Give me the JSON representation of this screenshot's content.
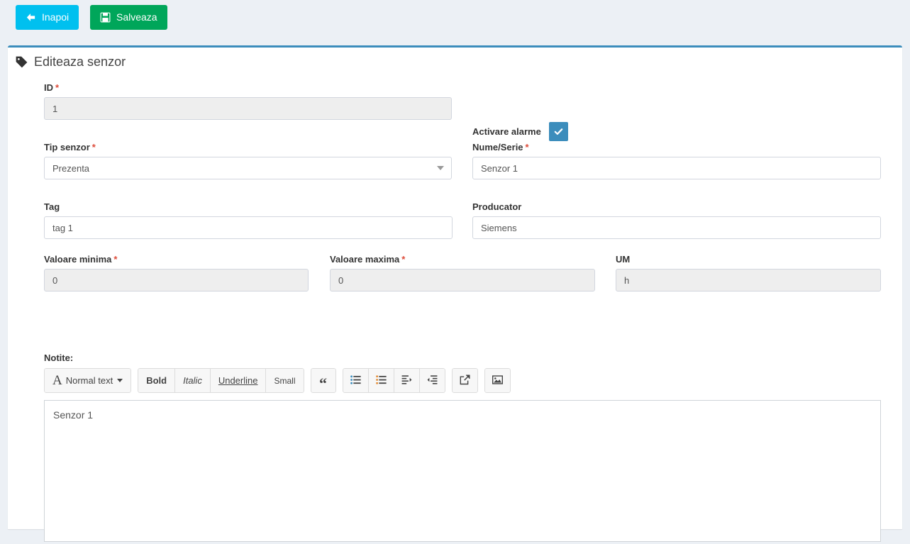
{
  "toolbar": {
    "back_label": "Inapoi",
    "back_icon": "arrow-left-icon",
    "save_label": "Salveaza",
    "save_icon": "floppy-disk-icon",
    "back_color": "#00c0ef",
    "save_color": "#00a65a"
  },
  "panel": {
    "title": "Editeaza senzor",
    "title_icon": "tag-icon",
    "accent_color": "#3c8dbc"
  },
  "form": {
    "id": {
      "label": "ID",
      "required": true,
      "value": "1",
      "disabled": true
    },
    "alarms": {
      "label": "Activare alarme",
      "checked": true,
      "check_color": "#3c8dbc"
    },
    "sensor_type": {
      "label": "Tip senzor",
      "required": true,
      "value": "Prezenta",
      "options": [
        "Prezenta"
      ]
    },
    "name_serial": {
      "label": "Nume/Serie",
      "required": true,
      "value": "Senzor 1",
      "disabled": false
    },
    "tag": {
      "label": "Tag",
      "required": false,
      "value": "tag 1",
      "disabled": false
    },
    "manufacturer": {
      "label": "Producator",
      "required": false,
      "value": "Siemens",
      "disabled": false
    },
    "min_value": {
      "label": "Valoare minima",
      "required": true,
      "value": "0",
      "disabled": true
    },
    "max_value": {
      "label": "Valoare maxima",
      "required": true,
      "value": "0",
      "disabled": true
    },
    "um": {
      "label": "UM",
      "required": false,
      "value": "h",
      "disabled": true
    },
    "required_marker": "*"
  },
  "notes": {
    "label": "Notite:",
    "content": "Senzor 1",
    "editor_toolbar": {
      "style_button": {
        "label": "Normal text",
        "icon": "font-size-icon"
      },
      "format_buttons": [
        {
          "label": "Bold",
          "name": "bold-button"
        },
        {
          "label": "Italic",
          "name": "italic-button"
        },
        {
          "label": "Underline",
          "name": "underline-button"
        },
        {
          "label": "Small",
          "name": "small-button"
        }
      ],
      "quote_button": {
        "icon": "blockquote-icon",
        "glyph": "“"
      },
      "list_buttons": [
        {
          "icon": "unordered-list-icon"
        },
        {
          "icon": "ordered-list-icon"
        },
        {
          "icon": "indent-right-icon"
        },
        {
          "icon": "indent-left-icon"
        }
      ],
      "link_button": {
        "icon": "insert-link-icon"
      },
      "image_button": {
        "icon": "insert-image-icon"
      }
    }
  }
}
